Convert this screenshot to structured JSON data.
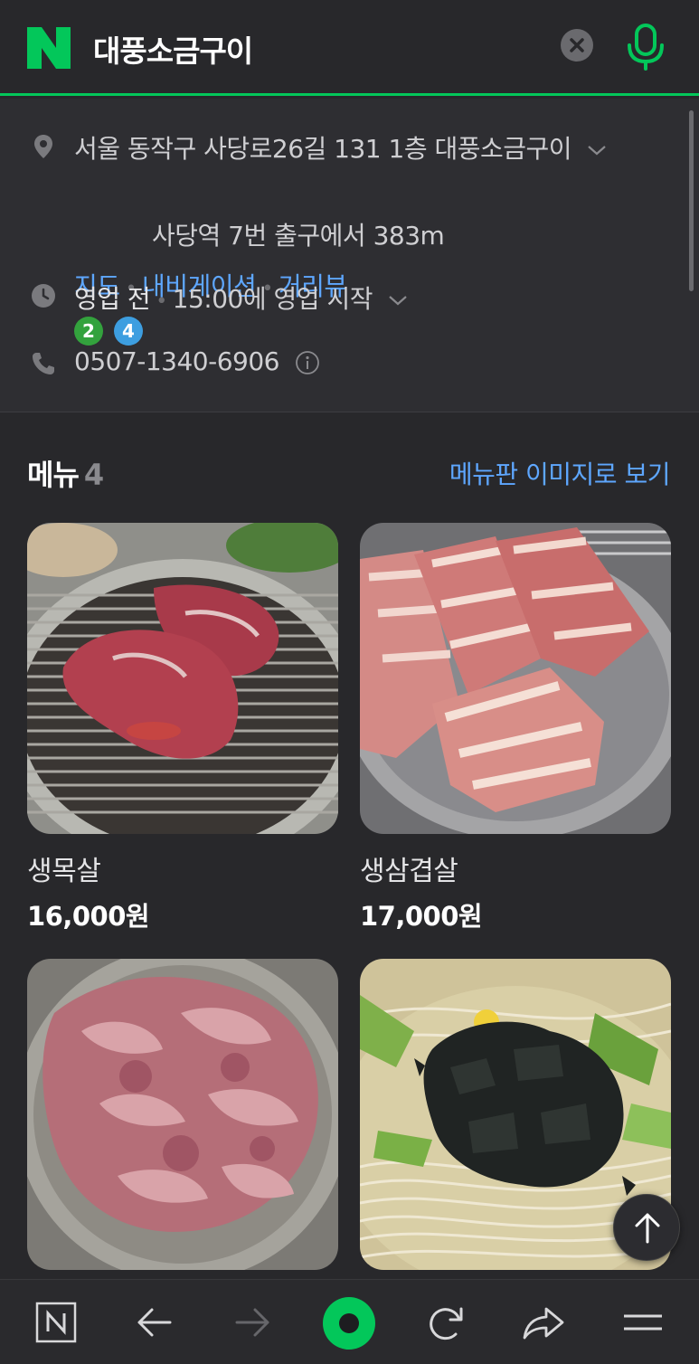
{
  "search": {
    "query": "대풍소금구이",
    "logo_letter": "N",
    "clear_icon": "close-icon",
    "mic_icon": "microphone-icon"
  },
  "place": {
    "address": "서울 동작구 사당로26길 131 1층 대풍소금구이",
    "links": [
      "지도",
      "내비게이션",
      "거리뷰"
    ],
    "subway_lines": [
      {
        "num": "2",
        "color": "#33a23d"
      },
      {
        "num": "4",
        "color": "#3d9ee0"
      }
    ],
    "subway_text": "사당역 7번 출구에서 383m",
    "status": "영업 전",
    "hours": "15:00에 영업 시작",
    "phone": "0507-1340-6906"
  },
  "menu": {
    "title": "메뉴",
    "count": "4",
    "view_link": "메뉴판 이미지로 보기",
    "items": [
      {
        "name": "생목살",
        "price": "16,000원"
      },
      {
        "name": "생삼겹살",
        "price": "17,000원"
      },
      {
        "name": "",
        "price": ""
      },
      {
        "name": "",
        "price": ""
      }
    ]
  },
  "colors": {
    "brand": "#03c75a",
    "link": "#5ea7ff",
    "background": "#28282b"
  },
  "bottom_nav": [
    "naver-home-icon",
    "back-arrow-icon",
    "forward-arrow-icon",
    "green-dot-icon",
    "refresh-icon",
    "share-icon",
    "menu-icon"
  ]
}
